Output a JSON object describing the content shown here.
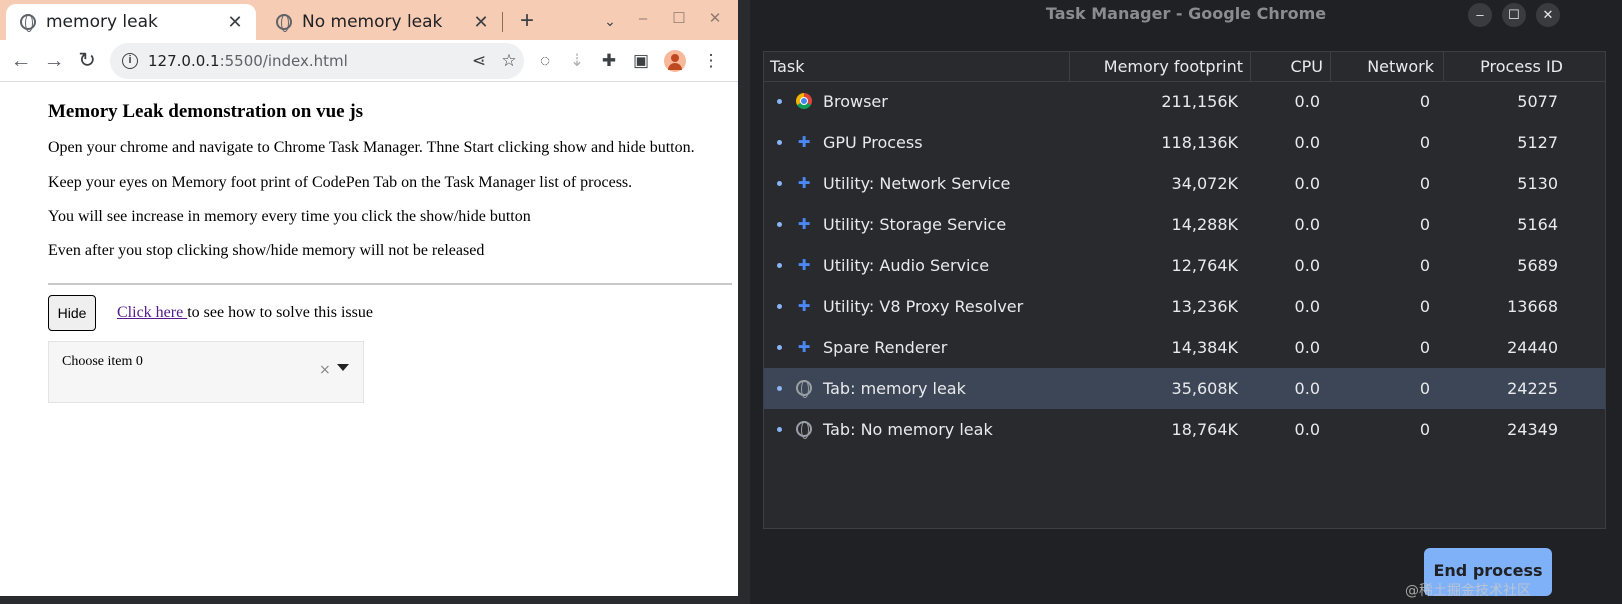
{
  "browser": {
    "tabs": [
      {
        "title": "memory leak",
        "icon": "globe-icon",
        "active": true
      },
      {
        "title": "No memory leak",
        "icon": "globe-icon",
        "active": false
      }
    ],
    "tab_close": "✕",
    "new_tab": "+",
    "tab_search": "⌄",
    "window_controls": {
      "minimize": "–",
      "maximize": "☐",
      "close": "✕"
    },
    "nav": {
      "back": "←",
      "forward": "→",
      "reload": "↻"
    },
    "url_host": "127.0.0.1",
    "url_path": ":5500/index.html",
    "menu": "⋮"
  },
  "page": {
    "heading": "Memory Leak demonstration on vue js",
    "paragraphs": [
      "Open your chrome and navigate to Chrome Task Manager. Thne Start clicking show and hide button.",
      "Keep your eyes on Memory foot print of CodePen Tab on the Task Manager list of process.",
      "You will see increase in memory every time you click the show/hide button",
      "Even after you stop clicking show/hide memory will not be released"
    ],
    "hide_button": "Hide",
    "click_link": "Click here ",
    "click_text": "to see how to solve this issue",
    "select_value": "Choose item 0",
    "select_clear": "×"
  },
  "task_manager": {
    "title": "Task Manager - Google Chrome",
    "columns": [
      "Task",
      "Memory footprint",
      "CPU",
      "Network",
      "Process ID"
    ],
    "rows": [
      {
        "task": "Browser",
        "icon": "chrome-icon",
        "memory": "211,156K",
        "cpu": "0.0",
        "network": "0",
        "pid": "5077",
        "selected": false
      },
      {
        "task": "GPU Process",
        "icon": "puzzle-icon",
        "memory": "118,136K",
        "cpu": "0.0",
        "network": "0",
        "pid": "5127",
        "selected": false
      },
      {
        "task": "Utility: Network Service",
        "icon": "puzzle-icon",
        "memory": "34,072K",
        "cpu": "0.0",
        "network": "0",
        "pid": "5130",
        "selected": false
      },
      {
        "task": "Utility: Storage Service",
        "icon": "puzzle-icon",
        "memory": "14,288K",
        "cpu": "0.0",
        "network": "0",
        "pid": "5164",
        "selected": false
      },
      {
        "task": "Utility: Audio Service",
        "icon": "puzzle-icon",
        "memory": "12,764K",
        "cpu": "0.0",
        "network": "0",
        "pid": "5689",
        "selected": false
      },
      {
        "task": "Utility: V8 Proxy Resolver",
        "icon": "puzzle-icon",
        "memory": "13,236K",
        "cpu": "0.0",
        "network": "0",
        "pid": "13668",
        "selected": false
      },
      {
        "task": "Spare Renderer",
        "icon": "puzzle-icon",
        "memory": "14,384K",
        "cpu": "0.0",
        "network": "0",
        "pid": "24440",
        "selected": false
      },
      {
        "task": "Tab: memory leak",
        "icon": "globe-icon",
        "memory": "35,608K",
        "cpu": "0.0",
        "network": "0",
        "pid": "24225",
        "selected": true
      },
      {
        "task": "Tab: No memory leak",
        "icon": "globe-icon",
        "memory": "18,764K",
        "cpu": "0.0",
        "network": "0",
        "pid": "24349",
        "selected": false
      }
    ],
    "end_process": "End process",
    "window_controls": {
      "minimize": "–",
      "maximize": "☐",
      "close": "✕"
    }
  },
  "watermark": "@稀土掘金技术社区",
  "colors": {
    "tabstrip": "#f7ccb5",
    "tm_bg": "#202124",
    "selected_row": "#3d4656",
    "accent_button": "#7fb1f8",
    "link": "#551a8b"
  }
}
